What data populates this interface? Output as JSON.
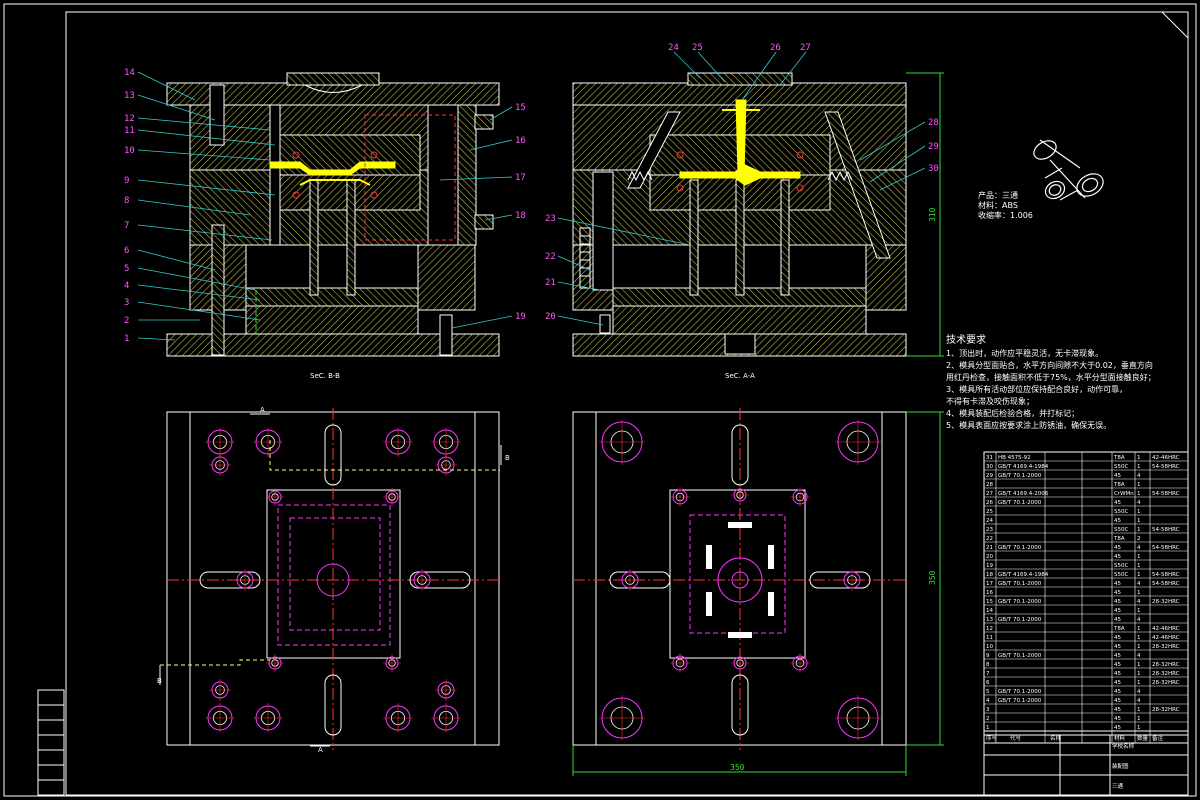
{
  "colors": {
    "background": "#000000",
    "frame": "#ffffff",
    "hatch": "#d4d45a",
    "runner": "#ffff00",
    "leader": "#33cccc",
    "center": "#ff3333",
    "hidden": "#cc33cc",
    "label": "#ff55ff",
    "dimension": "#33dd33"
  },
  "views": {
    "section_bb": "SeC. B-B",
    "section_aa": "SeC. A-A"
  },
  "left_labels": [
    "14",
    "13",
    "12",
    "11",
    "10",
    "9",
    "8",
    "7",
    "6",
    "5",
    "4",
    "3",
    "2",
    "1"
  ],
  "left_right_labels": [
    "15",
    "16",
    "17",
    "18",
    "19"
  ],
  "right_top_labels": [
    "24",
    "25",
    "26",
    "27"
  ],
  "right_left_labels": [
    "23",
    "22",
    "21",
    "20"
  ],
  "right_right_labels": [
    "28",
    "29",
    "30"
  ],
  "dimensions": {
    "width": "350",
    "height_section": "310",
    "height_plan": "350"
  },
  "product": {
    "name": "产品：三通",
    "material": "材料：ABS",
    "shrinkage": "收缩率：1.006"
  },
  "tech_title": "技术要求",
  "tech_lines": [
    "1、顶出时，动作应平稳灵活，无卡滞现象。",
    "2、模具分型面贴合，水平方向间隙不大于0.02，垂直方向",
    "用红丹检查，接触面积不低于75%，水平分型面接触良好；",
    "3、模具所有活动部位应保持配合良好，动作可靠，",
    "不得有卡滞及咬伤现象；",
    "4、模具装配后检验合格，并打标记；",
    "5、模具表面应按要求涂上防锈油，确保无误。"
  ],
  "bom_rows": [
    [
      "31",
      "HB 4575-92",
      "",
      "T8A",
      "1",
      "42-46HRC"
    ],
    [
      "30",
      "GB/T 4169.4-1984",
      "",
      "S50C",
      "1",
      "54-58HRC"
    ],
    [
      "29",
      "GB/T 70.1-2000",
      "",
      "45",
      "4",
      ""
    ],
    [
      "28",
      "",
      "",
      "T8A",
      "1",
      ""
    ],
    [
      "27",
      "GB/T 4169.4-2006",
      "",
      "CrWMn",
      "1",
      "54-58HRC"
    ],
    [
      "26",
      "GB/T 70.1-2000",
      "",
      "45",
      "4",
      ""
    ],
    [
      "25",
      "",
      "",
      "S50C",
      "1",
      ""
    ],
    [
      "24",
      "",
      "",
      "45",
      "1",
      ""
    ],
    [
      "23",
      "",
      "",
      "S50C",
      "1",
      "54-58HRC"
    ],
    [
      "22",
      "",
      "",
      "T8A",
      "2",
      ""
    ],
    [
      "21",
      "GB/T 70.1-2000",
      "",
      "45",
      "4",
      "54-58HRC"
    ],
    [
      "20",
      "",
      "",
      "45",
      "1",
      ""
    ],
    [
      "19",
      "",
      "",
      "S50C",
      "1",
      ""
    ],
    [
      "18",
      "GB/T 4169.4-1984",
      "",
      "S50C",
      "1",
      "54-58HRC"
    ],
    [
      "17",
      "GB/T 70.1-2000",
      "",
      "45",
      "4",
      "54-58HRC"
    ],
    [
      "16",
      "",
      "",
      "45",
      "1",
      ""
    ],
    [
      "15",
      "GB/T 70.1-2000",
      "",
      "45",
      "4",
      "28-32HRC"
    ],
    [
      "14",
      "",
      "",
      "45",
      "1",
      ""
    ],
    [
      "13",
      "GB/T 70.1-2000",
      "",
      "45",
      "4",
      ""
    ],
    [
      "12",
      "",
      "",
      "T8A",
      "1",
      "42-46HRC"
    ],
    [
      "11",
      "",
      "",
      "45",
      "1",
      "42-46HRC"
    ],
    [
      "10",
      "",
      "",
      "45",
      "1",
      "28-32HRC"
    ],
    [
      "9",
      "GB/T 70.1-2000",
      "",
      "45",
      "4",
      ""
    ],
    [
      "8",
      "",
      "",
      "45",
      "1",
      "28-32HRC"
    ],
    [
      "7",
      "",
      "",
      "45",
      "1",
      "28-32HRC"
    ],
    [
      "6",
      "",
      "",
      "45",
      "1",
      "28-32HRC"
    ],
    [
      "5",
      "GB/T 70.1-2000",
      "",
      "45",
      "4",
      ""
    ],
    [
      "4",
      "GB/T 70.1-2000",
      "",
      "45",
      "4",
      ""
    ],
    [
      "3",
      "",
      "",
      "45",
      "1",
      "28-32HRC"
    ],
    [
      "2",
      "",
      "",
      "45",
      "1",
      ""
    ],
    [
      "1",
      "",
      "",
      "45",
      "1",
      ""
    ]
  ],
  "bom_header": [
    "序号",
    "代号",
    "名称",
    "材料",
    "数量",
    "备注"
  ],
  "title_block": {
    "school": "学校名称",
    "drawing": "装配图",
    "part": "三通"
  }
}
